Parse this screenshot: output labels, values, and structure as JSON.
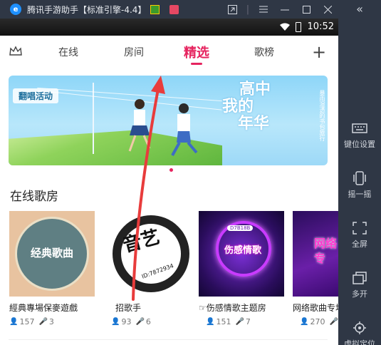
{
  "titlebar": {
    "title": "腾讯手游助手【标准引擎-4.4】",
    "logo_letter": "e"
  },
  "sidebar": {
    "items": [
      {
        "label": "键位设置",
        "icon": "keyboard-icon"
      },
      {
        "label": "摇一摇",
        "icon": "shake-icon"
      },
      {
        "label": "全屏",
        "icon": "fullscreen-icon"
      },
      {
        "label": "多开",
        "icon": "multi-window-icon"
      },
      {
        "label": "虚拟定位",
        "icon": "location-icon"
      }
    ]
  },
  "statusbar": {
    "time": "10:52"
  },
  "nav": {
    "tabs": [
      {
        "label": "在线",
        "active": false
      },
      {
        "label": "房间",
        "active": false
      },
      {
        "label": "精选",
        "active": true
      },
      {
        "label": "歌榜",
        "active": false
      }
    ]
  },
  "banner": {
    "label": "翻唱活动",
    "title_line1": "高中",
    "title_line2": "我的",
    "title_line3": "年华",
    "side_text": "暴雨湿透的书包旅行"
  },
  "section": {
    "title": "在线歌房"
  },
  "rooms": [
    {
      "name": "經典專場保麥遊戲",
      "thumb_text": "经典歌曲",
      "listeners": "157",
      "singers": "3"
    },
    {
      "name": "招歌手",
      "thumb_text": "音艺",
      "thumb_sub": "ID:7872934",
      "listeners": "93",
      "singers": "6"
    },
    {
      "name": "☞伤感情歌主题房",
      "thumb_text": "伤感情歌",
      "thumb_badge": "D7B18B",
      "listeners": "151",
      "singers": "7"
    },
    {
      "name": "网络歌曲专场",
      "thumb_text": "网络专",
      "listeners": "270",
      "singers": "8"
    }
  ],
  "colors": {
    "accent": "#e6245f",
    "emulator_chrome": "#2f3745",
    "annotation_arrow": "#e83c3c"
  }
}
